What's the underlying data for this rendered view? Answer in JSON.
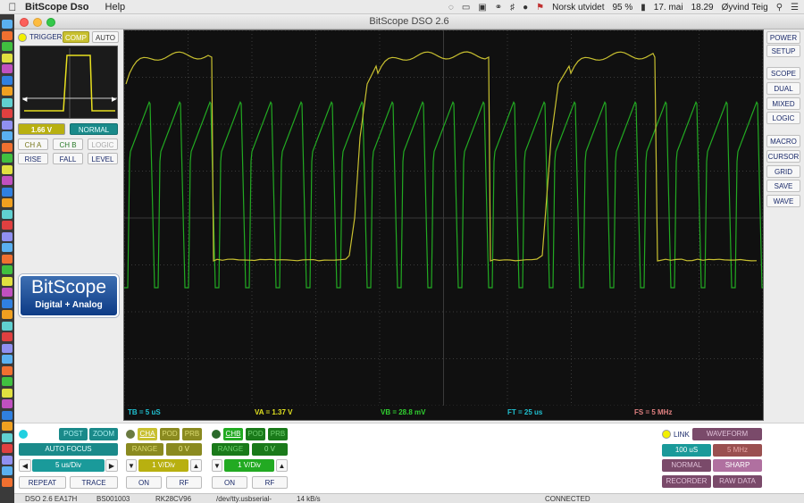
{
  "menubar": {
    "app_name": "BitScope Dso",
    "menu_help": "Help",
    "input_source": "Norsk utvidet",
    "battery": "95 %",
    "date": "17. mai",
    "time": "18.29",
    "user": "Øyvind Teig"
  },
  "window": {
    "title": "BitScope DSO 2.6"
  },
  "trigger": {
    "label": "TRIGGER",
    "comp": "COMP",
    "auto": "AUTO",
    "level": "1.66 V",
    "mode": "NORMAL",
    "ch_a": "CH A",
    "ch_b": "CH B",
    "logic": "LOGIC",
    "rise": "RISE",
    "fall": "FALL",
    "level_btn": "LEVEL"
  },
  "logo": {
    "brand": "BitScope",
    "tagline": "Digital + Analog"
  },
  "scope_status": {
    "tb": "TB = 5 uS",
    "va": "VA = 1.37 V",
    "vb": "VB = 28.8 mV",
    "ft": "FT = 25 us",
    "fs": "FS = 5 MHz"
  },
  "right_buttons": [
    "POWER",
    "SETUP",
    "SCOPE",
    "DUAL",
    "MIXED",
    "LOGIC",
    "MACRO",
    "CURSOR",
    "GRID",
    "SAVE",
    "WAVE"
  ],
  "timebase": {
    "post": "POST",
    "zoom": "ZOOM",
    "autofocus": "AUTO FOCUS",
    "value": "5 us/Div",
    "repeat": "REPEAT",
    "trace": "TRACE"
  },
  "channel_a": {
    "name": "CHA",
    "pod": "POD",
    "prb": "PRB",
    "range": "RANGE",
    "offset": "0 V",
    "value": "1 V/Div",
    "on": "ON",
    "rf": "RF"
  },
  "channel_b": {
    "name": "CHB",
    "pod": "POD",
    "prb": "PRB",
    "range": "RANGE",
    "offset": "0 V",
    "value": "1 V/Div",
    "on": "ON",
    "rf": "RF"
  },
  "waveform": {
    "link": "LINK",
    "waveform": "WAVEFORM",
    "period": "100 uS",
    "freq": "5 MHz",
    "normal": "NORMAL",
    "sharp": "SHARP",
    "recorder": "RECORDER",
    "raw": "RAW DATA"
  },
  "statusbar": {
    "version": "DSO 2.6 EA17H",
    "device": "BS001003",
    "serial": "RK28CV96",
    "port": "/dev/tty.usbserial-",
    "rate": "14 kB/s",
    "state": "CONNECTED"
  },
  "colors": {
    "ch_a": "#c8c030",
    "ch_b": "#22aa22",
    "grid": "#3a3a3a",
    "teal": "#1a8a8a"
  }
}
